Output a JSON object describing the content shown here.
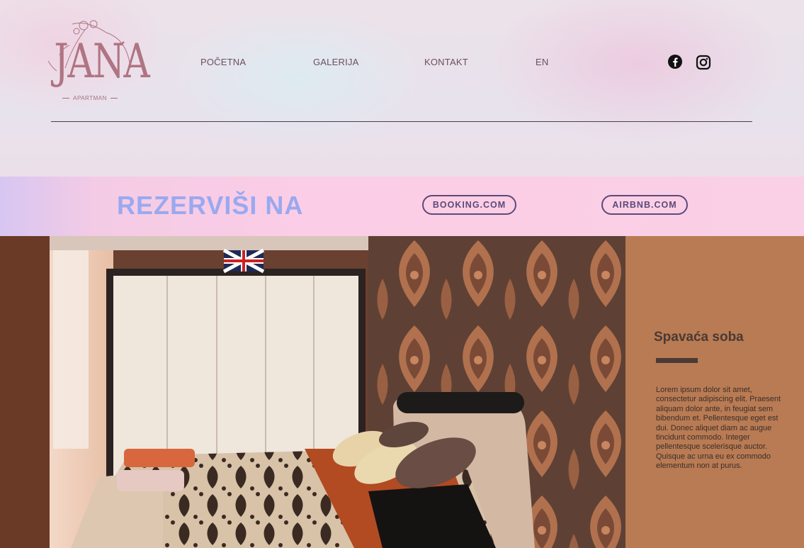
{
  "brand": {
    "logo_name": "JANA",
    "logo_subtitle": "APARTMAN"
  },
  "nav": {
    "items": [
      "POČETNA",
      "GALERIJA",
      "KONTAKT",
      "EN"
    ]
  },
  "social": {
    "facebook_icon": "facebook-icon",
    "instagram_icon": "instagram-icon"
  },
  "booking": {
    "title": "REZERVIŠI NA",
    "booking_label": "BOOKING.COM",
    "airbnb_label": "AIRBNB.COM"
  },
  "room": {
    "title": "Spavaća soba",
    "description": "Lorem ipsum dolor sit amet, consectetur adipiscing elit. Praesent aliquam dolor ante, in feugiat sem bibendum et. Pellentesque eget est dui. Donec aliquet diam ac augue tincidunt commodo. Integer pellentesque scelerisque auctor. Quisque ac urna eu ex commodo elementum non at purus."
  },
  "colors": {
    "accent_pink": "#fccde6",
    "title_blue": "#9aa9ef",
    "pill_border": "#5c4a79",
    "side_panel": "#b97b53",
    "logo_rose": "#b07482"
  }
}
